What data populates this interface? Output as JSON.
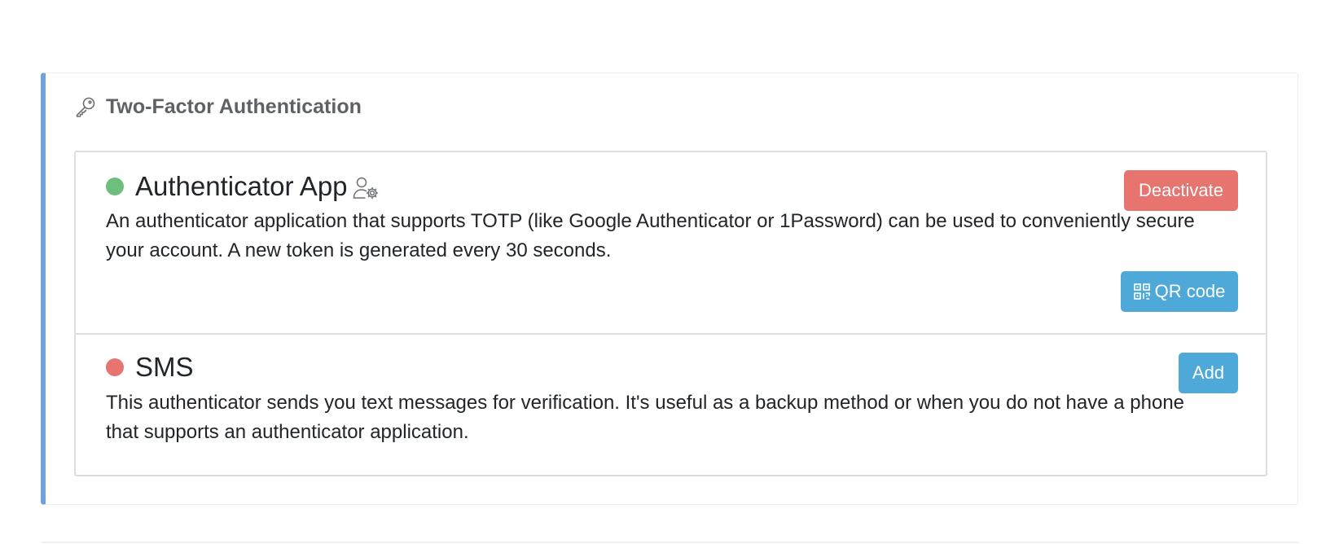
{
  "card": {
    "title": "Two-Factor Authentication",
    "icon": "key-icon",
    "accent_color": "#6da2dc"
  },
  "methods": {
    "authenticator_app": {
      "name": "Authenticator App",
      "status": "active",
      "status_color": "#6cbf7d",
      "icon": "user-gear-icon",
      "description": "An authenticator application that supports TOTP (like Google Authenticator or 1Password) can be used to conveniently secure your account. A new token is generated every 30 seconds.",
      "deactivate_label": "Deactivate",
      "qr_label": "QR code",
      "qr_icon": "qr-code-icon"
    },
    "sms": {
      "name": "SMS",
      "status": "inactive",
      "status_color": "#e8746f",
      "description": "This authenticator sends you text messages for verification. It's useful as a backup method or when you do not have a phone that supports an authenticator application.",
      "add_label": "Add"
    }
  },
  "colors": {
    "danger": "#e8746f",
    "primary": "#4ea8d8",
    "success": "#6cbf7d"
  }
}
